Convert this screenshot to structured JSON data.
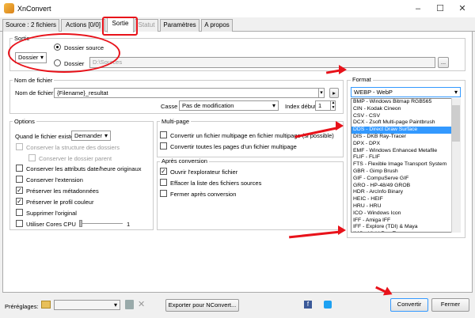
{
  "window": {
    "title": "XnConvert"
  },
  "tabs": [
    {
      "label": "Source : 2 fichiers"
    },
    {
      "label": "Actions [0/0]"
    },
    {
      "label": "Sortie"
    },
    {
      "label": "Statut"
    },
    {
      "label": "Paramètres"
    },
    {
      "label": "A propos"
    }
  ],
  "sortie": {
    "group_label": "Sortie",
    "dest_select": "Dossier",
    "radio_source": "Dossier source",
    "radio_dossier": "Dossier",
    "path": "D:\\Sources",
    "browse": "..."
  },
  "filename": {
    "group_label": "Nom de fichier",
    "label": "Nom de fichier",
    "value": "{Filename}_resultat",
    "casse_label": "Casse",
    "casse_value": "Pas de modification",
    "index_label": "Index début",
    "index_value": "1"
  },
  "format": {
    "group_label": "Format",
    "selected": "WEBP - WebP",
    "items": [
      "BMP - Windows Bitmap RGB565",
      "CIN - Kodak Cineon",
      "CSV - CSV",
      "DCX - Zsoft Multi-page Paintbrush",
      "DDS - Direct Draw Surface",
      "DIS - DKB Ray-Tracer",
      "DPX - DPX",
      "EMF - Windows Enhanced Metafile",
      "FLIF - FLIF",
      "FTS - Flexible Image Transport System",
      "GBR - Gimp Brush",
      "GIF - CompuServe GIF",
      "GRO - HP-48/49 GROB",
      "HDR - ArcInfo Binary",
      "HEIC - HEIF",
      "HRU - HRU",
      "ICO - Windows Icon",
      "IFF - Amiga IFF",
      "IFF - Explore (TDI) & Maya",
      "IMG - Vivid Ray-Tracer"
    ],
    "highlighted_index": 4
  },
  "options": {
    "group_label": "Options",
    "exists_label": "Quand le fichier existe",
    "exists_value": "Demander",
    "keep_structure": "Conserver la structure des dossiers",
    "keep_parent": "Conserver le dossier parent",
    "keep_dates": "Conserver les attributs date/heure originaux",
    "keep_ext": "Conserver l'extension",
    "keep_meta": "Préserver les métadonnées",
    "keep_profile": "Préserver le profil couleur",
    "delete_orig": "Supprimer l'original",
    "cores": "Utiliser Cores CPU",
    "cores_value": "1"
  },
  "multipage": {
    "group_label": "Multi-page",
    "convert_one": "Convertir un fichier multipage en fichier multipage (si possible)",
    "convert_all": "Convertir toutes les pages d'un fichier multipage"
  },
  "after": {
    "group_label": "Après conversion",
    "open_explorer": "Ouvrir l'explorateur fichier",
    "clear_list": "Effacer la liste des fichiers sources",
    "close_after": "Fermer après conversion"
  },
  "bottom": {
    "presets_label": "Préréglages:",
    "export": "Exporter pour NConvert...",
    "convert": "Convertir",
    "close": "Fermer"
  }
}
